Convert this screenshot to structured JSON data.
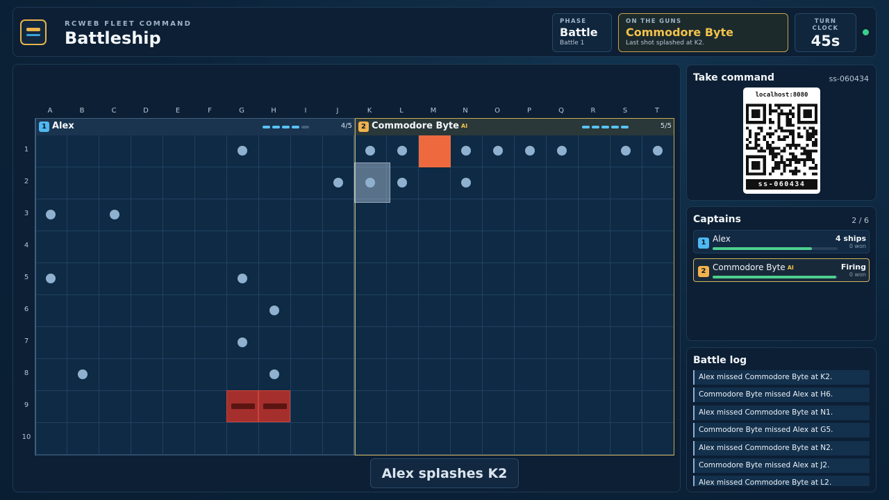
{
  "header": {
    "subtitle": "RCWEB FLEET COMMAND",
    "title": "Battleship",
    "phase": {
      "label": "PHASE",
      "value": "Battle",
      "sub": "Battle 1"
    },
    "guns": {
      "label": "ON THE GUNS",
      "value": "Commodore Byte",
      "sub": "Last shot splashed at K2."
    },
    "clock": {
      "label": "TURN CLOCK",
      "value": "45s"
    },
    "status_color": "#39d08c"
  },
  "board": {
    "columns": [
      "A",
      "B",
      "C",
      "D",
      "E",
      "F",
      "G",
      "H",
      "I",
      "J",
      "K",
      "L",
      "M",
      "N",
      "O",
      "P",
      "Q",
      "R",
      "S",
      "T"
    ],
    "rows": [
      "1",
      "2",
      "3",
      "4",
      "5",
      "6",
      "7",
      "8",
      "9",
      "10"
    ],
    "fleets": [
      {
        "num": "1",
        "name": "Alex",
        "ai": "",
        "count": "4/5",
        "ships_afloat": 4,
        "ships_total": 5,
        "color": "#4fb8f0"
      },
      {
        "num": "2",
        "name": "Commodore Byte",
        "ai": "AI",
        "count": "5/5",
        "ships_afloat": 5,
        "ships_total": 5,
        "color": "#f2b24c"
      }
    ],
    "misses": [
      "G1",
      "K1",
      "L1",
      "N1",
      "O1",
      "P1",
      "Q1",
      "S1",
      "T1",
      "J2",
      "K2",
      "L2",
      "N2",
      "A3",
      "C3",
      "A5",
      "G5",
      "H6",
      "G7",
      "B8",
      "H8"
    ],
    "hits": [
      "M1"
    ],
    "sunk": [
      "G9",
      "H9"
    ],
    "cursor": "K2"
  },
  "toast": "Alex splashes K2",
  "join": {
    "title": "Take command",
    "room_id": "ss-060434",
    "url": "localhost:8080",
    "code": "ss-060434"
  },
  "captains": {
    "title": "Captains",
    "count": "2 / 6",
    "list": [
      {
        "num": "1",
        "name": "Alex",
        "ai": "",
        "status": "4 ships",
        "won": "0 won",
        "health": 0.8,
        "color": "#4fb8f0"
      },
      {
        "num": "2",
        "name": "Commodore Byte",
        "ai": "AI",
        "status": "Firing",
        "won": "0 won",
        "health": 1.0,
        "color": "#f2b24c"
      }
    ]
  },
  "log": {
    "title": "Battle log",
    "entries": [
      "Alex missed Commodore Byte at K2.",
      "Commodore Byte missed Alex at H6.",
      "Alex missed Commodore Byte at N1.",
      "Commodore Byte missed Alex at G5.",
      "Alex missed Commodore Byte at N2.",
      "Commodore Byte missed Alex at J2.",
      "Alex missed Commodore Byte at L2."
    ]
  }
}
